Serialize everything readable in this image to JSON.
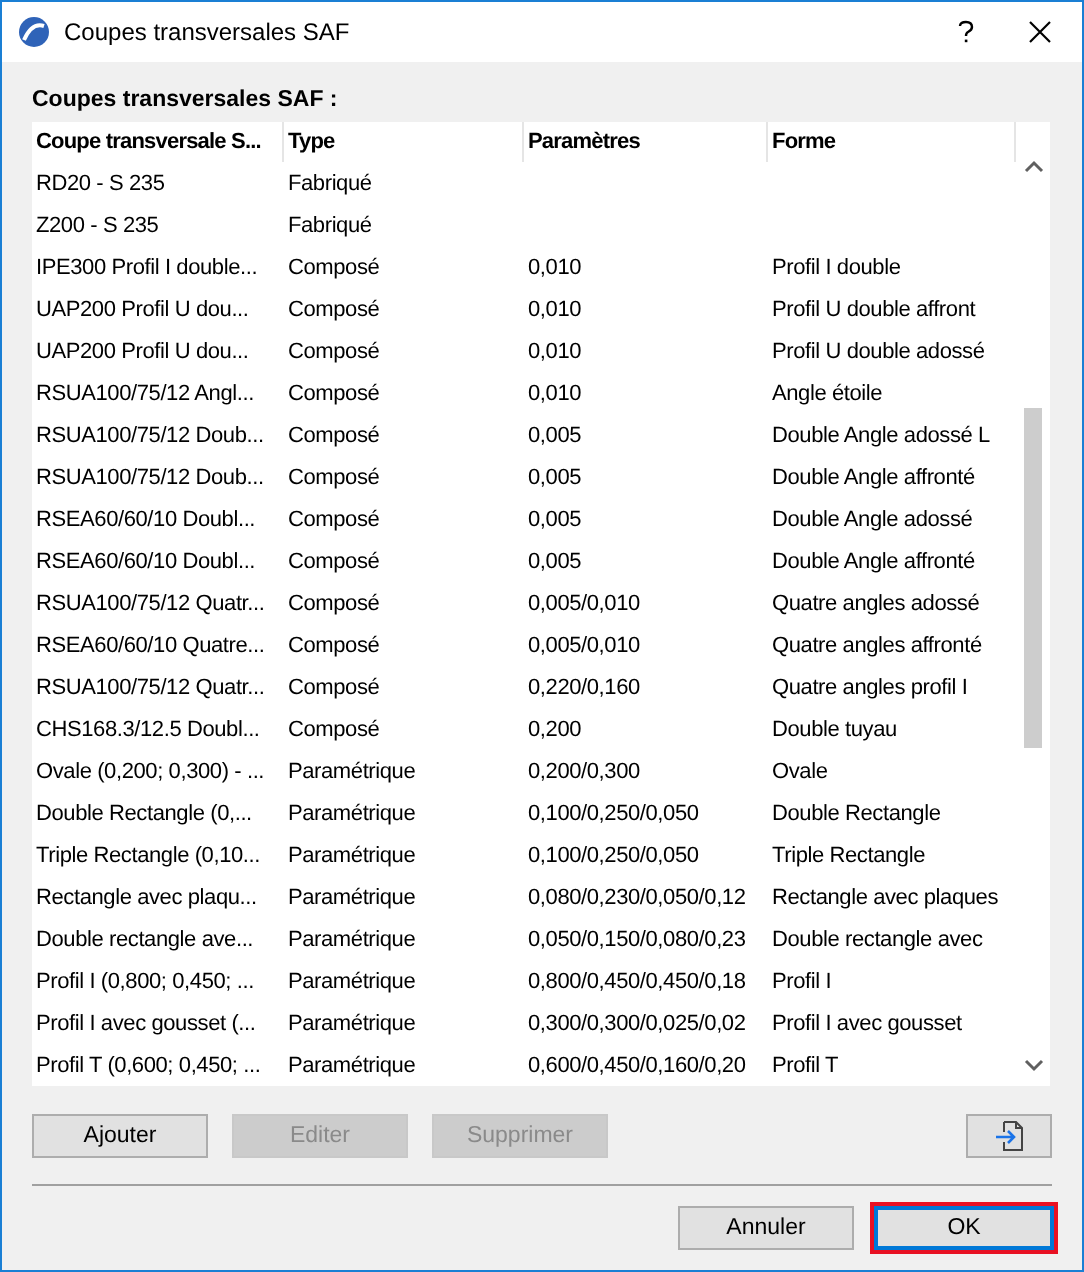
{
  "window": {
    "title": "Coupes transversales SAF"
  },
  "section_label": "Coupes transversales SAF :",
  "table": {
    "columns": [
      "Coupe transversale S...",
      "Type",
      "Paramètres",
      "Forme"
    ],
    "rows": [
      {
        "name": "RD20 - S 235",
        "type": "Fabriqué"
      },
      {
        "name": "Z200 - S 235",
        "type": "Fabriqué"
      },
      {
        "name": "IPE300 Profil I double...",
        "type": "Composé",
        "params": "0,010",
        "shape": "Profil I double"
      },
      {
        "name": "UAP200 Profil U dou...",
        "type": "Composé",
        "params": "0,010",
        "shape": "Profil U double affront"
      },
      {
        "name": "UAP200 Profil U dou...",
        "type": "Composé",
        "params": "0,010",
        "shape": "Profil U double adossé"
      },
      {
        "name": "RSUA100/75/12 Angl...",
        "type": "Composé",
        "params": "0,010",
        "shape": "Angle étoile"
      },
      {
        "name": "RSUA100/75/12 Doub...",
        "type": "Composé",
        "params": "0,005",
        "shape": "Double Angle adossé L"
      },
      {
        "name": "RSUA100/75/12 Doub...",
        "type": "Composé",
        "params": "0,005",
        "shape": "Double Angle affronté"
      },
      {
        "name": "RSEA60/60/10 Doubl...",
        "type": "Composé",
        "params": "0,005",
        "shape": "Double Angle adossé"
      },
      {
        "name": "RSEA60/60/10 Doubl...",
        "type": "Composé",
        "params": "0,005",
        "shape": "Double Angle affronté"
      },
      {
        "name": "RSUA100/75/12 Quatr...",
        "type": "Composé",
        "params": "0,005/0,010",
        "shape": "Quatre angles adossé"
      },
      {
        "name": "RSEA60/60/10 Quatre...",
        "type": "Composé",
        "params": "0,005/0,010",
        "shape": "Quatre angles affronté"
      },
      {
        "name": "RSUA100/75/12 Quatr...",
        "type": "Composé",
        "params": "0,220/0,160",
        "shape": "Quatre angles profil I"
      },
      {
        "name": "CHS168.3/12.5 Doubl...",
        "type": "Composé",
        "params": "0,200",
        "shape": "Double tuyau"
      },
      {
        "name": "Ovale (0,200; 0,300) - ...",
        "type": "Paramétrique",
        "params": "0,200/0,300",
        "shape": "Ovale"
      },
      {
        "name": "Double Rectangle (0,...",
        "type": "Paramétrique",
        "params": "0,100/0,250/0,050",
        "shape": "Double Rectangle"
      },
      {
        "name": "Triple Rectangle (0,10...",
        "type": "Paramétrique",
        "params": "0,100/0,250/0,050",
        "shape": "Triple Rectangle"
      },
      {
        "name": "Rectangle avec plaqu...",
        "type": "Paramétrique",
        "params": "0,080/0,230/0,050/0,12",
        "shape": "Rectangle avec plaques"
      },
      {
        "name": "Double rectangle ave...",
        "type": "Paramétrique",
        "params": "0,050/0,150/0,080/0,23",
        "shape": "Double rectangle avec"
      },
      {
        "name": "Profil I (0,800; 0,450; ...",
        "type": "Paramétrique",
        "params": "0,800/0,450/0,450/0,18",
        "shape": "Profil I"
      },
      {
        "name": "Profil I avec gousset (...",
        "type": "Paramétrique",
        "params": "0,300/0,300/0,025/0,02",
        "shape": "Profil I avec gousset"
      },
      {
        "name": "Profil T (0,600; 0,450; ...",
        "type": "Paramétrique",
        "params": "0,600/0,450/0,160/0,20",
        "shape": "Profil T"
      }
    ]
  },
  "actions": [
    {
      "label": "Ajouter",
      "disabled": false
    },
    {
      "label": "Editer",
      "disabled": true
    },
    {
      "label": "Supprimer",
      "disabled": true
    }
  ],
  "footer_buttons": [
    {
      "label": "Annuler",
      "default": false
    },
    {
      "label": "OK",
      "default": true
    }
  ]
}
